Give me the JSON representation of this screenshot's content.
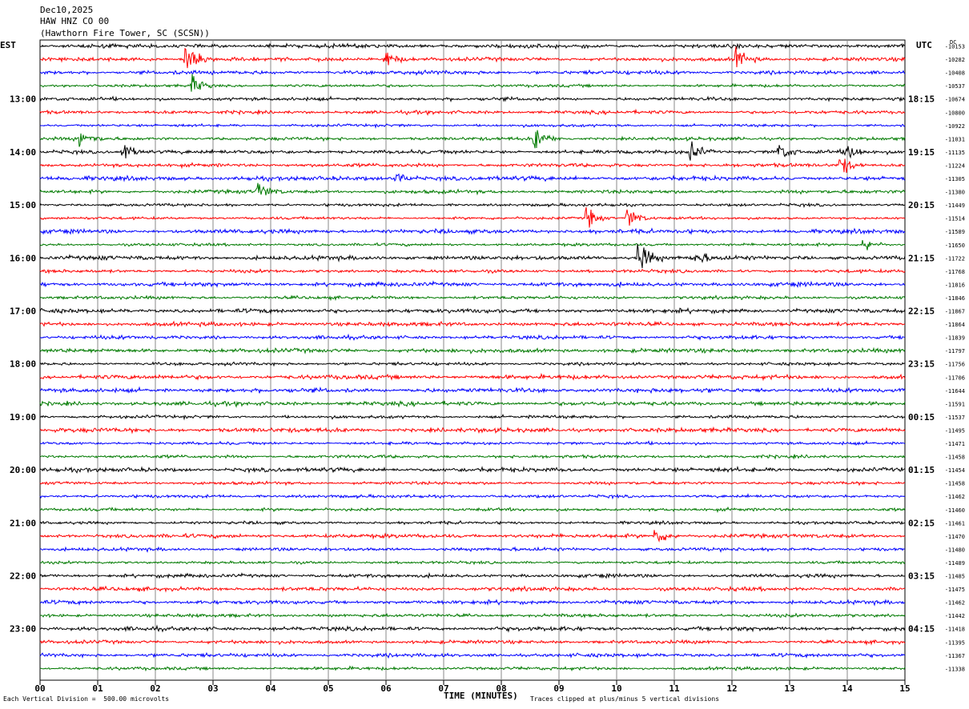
{
  "header": {
    "date": "Dec10,2025",
    "station": "HAW HNZ CO 00",
    "location": "(Hawthorn Fire Tower, SC (SCSN))"
  },
  "left_timezone": "EST",
  "right_timezone": "UTC",
  "dc_header": "DC",
  "chart_data": {
    "type": "line",
    "title": "",
    "xlabel": "TIME (MINUTES)",
    "ylabel": "",
    "xlim": [
      0,
      15
    ],
    "x_ticks": [
      "00",
      "01",
      "02",
      "03",
      "04",
      "05",
      "06",
      "07",
      "08",
      "09",
      "10",
      "11",
      "12",
      "13",
      "14",
      "15"
    ],
    "row_colors": [
      "#000000",
      "#ff0000",
      "#0000ff",
      "#007a00"
    ],
    "left_hour_labels": [
      "13:00",
      "14:00",
      "15:00",
      "16:00",
      "17:00",
      "18:00",
      "19:00",
      "20:00",
      "21:00",
      "22:00",
      "23:00"
    ],
    "right_hour_labels": [
      "18:15",
      "19:15",
      "20:15",
      "21:15",
      "22:15",
      "23:15",
      "00:15",
      "01:15",
      "02:15",
      "03:15",
      "04:15"
    ],
    "dc_offsets": [
      -10153,
      -10282,
      -10408,
      -10537,
      -10674,
      -10800,
      -10922,
      -11031,
      -11135,
      -11224,
      -11305,
      -11380,
      -11449,
      -11514,
      -11589,
      -11650,
      -11722,
      -11768,
      -11816,
      -11846,
      -11867,
      -11864,
      -11839,
      -11797,
      -11756,
      -11706,
      -11644,
      -11591,
      -11537,
      -11495,
      -11471,
      -11458,
      -11454,
      -11458,
      -11462,
      -11460,
      -11461,
      -11470,
      -11480,
      -11489,
      -11485,
      -11475,
      -11462,
      -11442,
      -11418,
      -11395,
      -11367,
      -11338
    ],
    "events": [
      {
        "trace": 1,
        "minute": 2.55,
        "amplitude": 13
      },
      {
        "trace": 1,
        "minute": 6.0,
        "amplitude": 8
      },
      {
        "trace": 1,
        "minute": 12.1,
        "amplitude": 9
      },
      {
        "trace": 3,
        "minute": 2.65,
        "amplitude": 8
      },
      {
        "trace": 7,
        "minute": 0.7,
        "amplitude": 8
      },
      {
        "trace": 7,
        "minute": 8.6,
        "amplitude": 10
      },
      {
        "trace": 8,
        "minute": 1.45,
        "amplitude": 9
      },
      {
        "trace": 8,
        "minute": 11.3,
        "amplitude": 8
      },
      {
        "trace": 8,
        "minute": 12.8,
        "amplitude": 9
      },
      {
        "trace": 8,
        "minute": 14.0,
        "amplitude": 8
      },
      {
        "trace": 9,
        "minute": 13.9,
        "amplitude": 9
      },
      {
        "trace": 10,
        "minute": 6.2,
        "amplitude": 8
      },
      {
        "trace": 11,
        "minute": 3.8,
        "amplitude": 7
      },
      {
        "trace": 13,
        "minute": 9.5,
        "amplitude": 9
      },
      {
        "trace": 13,
        "minute": 10.2,
        "amplitude": 10
      },
      {
        "trace": 15,
        "minute": 14.3,
        "amplitude": 7
      },
      {
        "trace": 16,
        "minute": 10.4,
        "amplitude": 14
      },
      {
        "trace": 16,
        "minute": 11.4,
        "amplitude": 5
      },
      {
        "trace": 37,
        "minute": 10.7,
        "amplitude": 7
      }
    ]
  },
  "footer": {
    "scale_note": "Each Vertical Division =  500.00 microvolts",
    "clip_note": "Traces clipped at plus/minus 5 vertical divisions"
  }
}
